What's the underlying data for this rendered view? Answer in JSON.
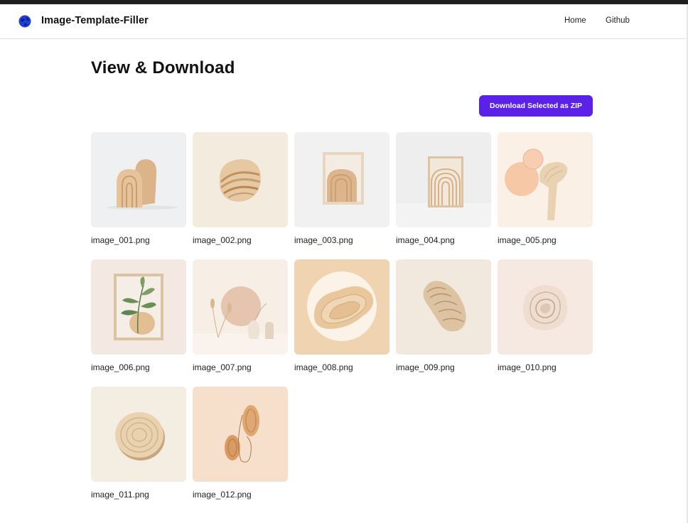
{
  "app": {
    "brand": "Image-Template-Filler",
    "nav": {
      "home": "Home",
      "github": "Github"
    }
  },
  "page": {
    "title": "View & Download",
    "download_button": "Download Selected as ZIP"
  },
  "colors": {
    "accent": "#5b21e6"
  },
  "images": [
    {
      "name": "image_001.png",
      "icon": "wood-arches-image"
    },
    {
      "name": "image_002.png",
      "icon": "wood-stone-image"
    },
    {
      "name": "image_003.png",
      "icon": "framed-arch-image"
    },
    {
      "name": "image_004.png",
      "icon": "framed-rings-image"
    },
    {
      "name": "image_005.png",
      "icon": "peach-circles-image"
    },
    {
      "name": "image_006.png",
      "icon": "framed-leaf-image"
    },
    {
      "name": "image_007.png",
      "icon": "vases-sun-image"
    },
    {
      "name": "image_008.png",
      "icon": "wood-blob-image"
    },
    {
      "name": "image_009.png",
      "icon": "wood-pebble-image"
    },
    {
      "name": "image_010.png",
      "icon": "ripple-texture-image"
    },
    {
      "name": "image_011.png",
      "icon": "wood-slice-image"
    },
    {
      "name": "image_012.png",
      "icon": "wood-ovals-image"
    }
  ]
}
